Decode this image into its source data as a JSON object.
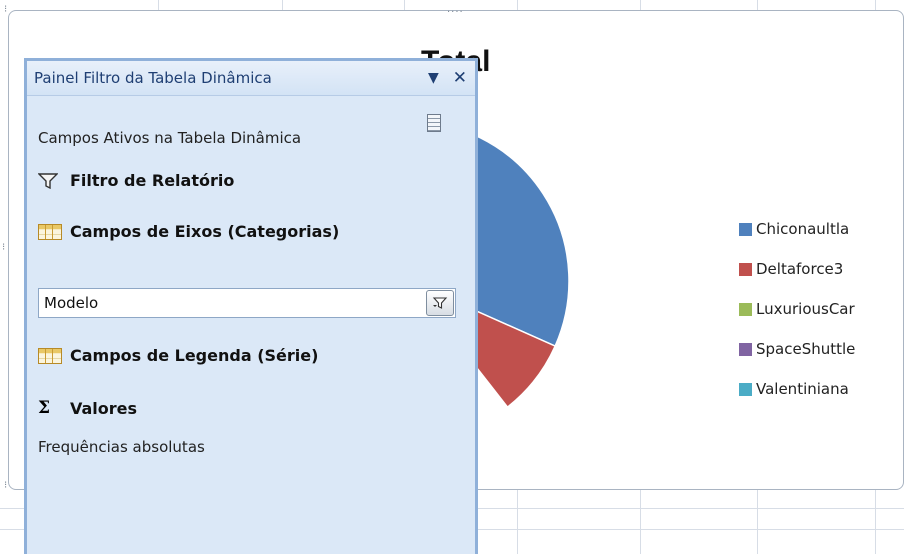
{
  "pane": {
    "title": "Painel Filtro da Tabela Dinâmica",
    "active_fields_label": "Campos Ativos na Tabela Dinâmica",
    "sections": {
      "report_filter": "Filtro de Relatório",
      "axis_fields": "Campos de Eixos (Categorias)",
      "legend_fields": "Campos de Legenda (Série)",
      "values": "Valores"
    },
    "axis_field_value": "Modelo",
    "values_item": "Frequências absolutas",
    "icons": {
      "dropdown": "chevron-down-icon",
      "close": "close-icon",
      "field_list": "field-list-icon",
      "filter": "funnel-icon",
      "axis": "table-grid-icon",
      "legend": "table-grid-icon",
      "values": "sigma-icon",
      "field_filter": "filter-dropdown-icon"
    }
  },
  "chart_data": {
    "type": "pie",
    "title": "Total",
    "categories": [
      "Chiconaultla",
      "Deltaforce3",
      "LuxuriousCar",
      "SpaceShuttle",
      "Valentiniana"
    ],
    "colors": [
      "#4F81BD",
      "#C0504D",
      "#9BBB59",
      "#8064A2",
      "#4BACC6"
    ],
    "legend_position": "right",
    "visible_slices": [
      "Chiconaultla",
      "Deltaforce3"
    ]
  }
}
